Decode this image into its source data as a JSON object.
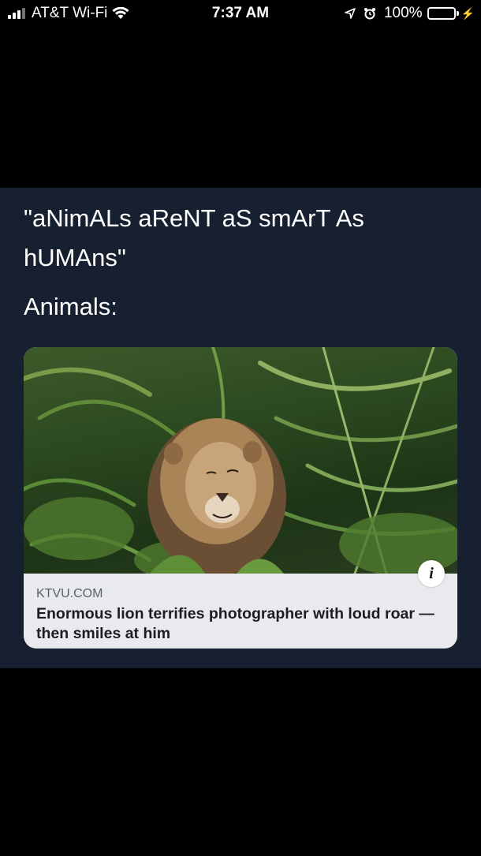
{
  "status_bar": {
    "carrier": "AT&T Wi-Fi",
    "time": "7:37 AM",
    "battery_percent": "100%",
    "battery_level": 1.0,
    "icons": [
      "signal-icon",
      "wifi-icon",
      "location-icon",
      "alarm-icon",
      "battery-icon",
      "charging-icon"
    ]
  },
  "post": {
    "line1": "\"aNimALs aReNT aS smArT As hUMAns\"",
    "line2": "Animals:"
  },
  "link_card": {
    "domain": "KTVU.COM",
    "title": "Enormous lion terrifies photographer with loud roar — then smiles at him",
    "image": "lion-photo",
    "info_icon": "info-icon"
  }
}
